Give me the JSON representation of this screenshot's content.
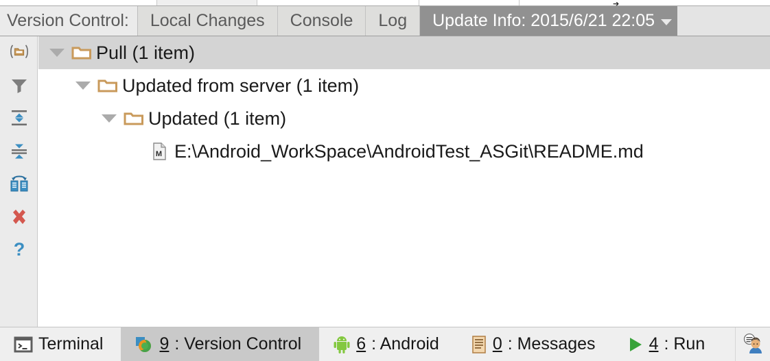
{
  "window": {
    "label": "Version Control:"
  },
  "tabs": [
    {
      "label": "Local Changes",
      "active": false
    },
    {
      "label": "Console",
      "active": false
    },
    {
      "label": "Log",
      "active": false
    },
    {
      "label": "Update Info: 2015/6/21 22:05",
      "active": true,
      "has_dropdown": true
    }
  ],
  "toolbar": {
    "items": [
      {
        "icon": "group-by-directory-icon",
        "name": "group-by-directory-button"
      },
      {
        "icon": "filter-icon",
        "name": "filter-button"
      },
      {
        "icon": "expand-all-icon",
        "name": "expand-all-button"
      },
      {
        "icon": "collapse-all-icon",
        "name": "collapse-all-button"
      },
      {
        "icon": "refresh-compare-icon",
        "name": "refresh-button"
      },
      {
        "icon": "close-icon",
        "name": "close-button"
      },
      {
        "icon": "help-icon",
        "name": "help-button"
      }
    ]
  },
  "tree": {
    "rows": [
      {
        "label": "Pull (1 item)",
        "depth": 0,
        "icon": "folder-icon",
        "expanded": true,
        "selected": true
      },
      {
        "label": "Updated from server (1 item)",
        "depth": 1,
        "icon": "folder-icon",
        "expanded": true,
        "selected": false
      },
      {
        "label": "Updated (1 item)",
        "depth": 2,
        "icon": "folder-icon",
        "expanded": true,
        "selected": false
      },
      {
        "label": "E:\\Android_WorkSpace\\AndroidTest_ASGit\\README.md",
        "depth": 3,
        "icon": "markdown-file-icon",
        "expanded": null,
        "selected": false
      }
    ]
  },
  "statusbar": {
    "tabs": [
      {
        "icon": "terminal-icon",
        "mnemonic": "",
        "label": "Terminal",
        "active": false
      },
      {
        "icon": "version-control-icon",
        "mnemonic": "9",
        "label": ": Version Control",
        "active": true
      },
      {
        "icon": "android-icon",
        "mnemonic": "6",
        "label": ": Android",
        "active": false
      },
      {
        "icon": "messages-icon",
        "mnemonic": "0",
        "label": ": Messages",
        "active": false
      },
      {
        "icon": "run-icon",
        "mnemonic": "4",
        "label": ": Run",
        "active": false
      }
    ],
    "right_icon": "event-log-icon"
  },
  "colors": {
    "tab_active_bg": "#919191",
    "tab_bg": "#dededc",
    "row_selected_bg": "#d4d4d4",
    "folder": "#c99a5b",
    "accent_blue": "#3b8ec2",
    "close_red": "#d4584f",
    "android_green": "#83c840",
    "run_green": "#38a33a"
  }
}
